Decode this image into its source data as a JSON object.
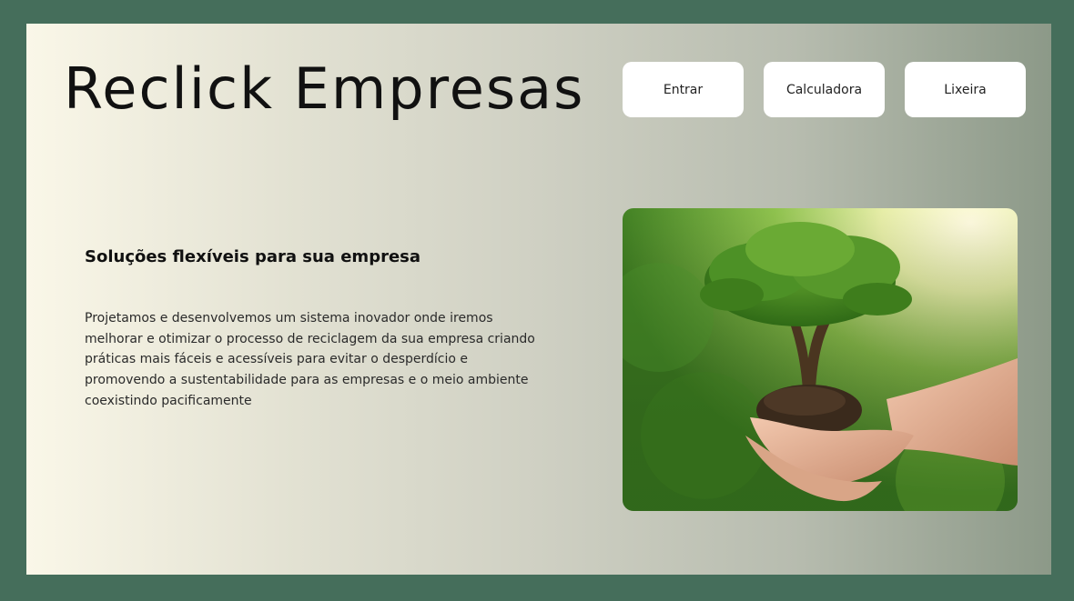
{
  "header": {
    "brand": "Reclick Empresas",
    "nav": {
      "entrar": "Entrar",
      "calculadora": "Calculadora",
      "lixeira": "Lixeira"
    }
  },
  "hero": {
    "headline": "Soluções flexíveis para sua empresa",
    "description": "Projetamos e desenvolvemos um sistema inovador onde iremos melhorar e otimizar o processo de reciclagem da sua empresa criando práticas mais fáceis e acessíveis para evitar o desperdício e promovendo a sustentabilidade para as empresas e o meio ambiente coexistindo pacificamente",
    "image": "tree-in-hands-photo"
  },
  "colors": {
    "frame": "#456e5b",
    "button_bg": "#ffffff",
    "text": "#111111"
  }
}
